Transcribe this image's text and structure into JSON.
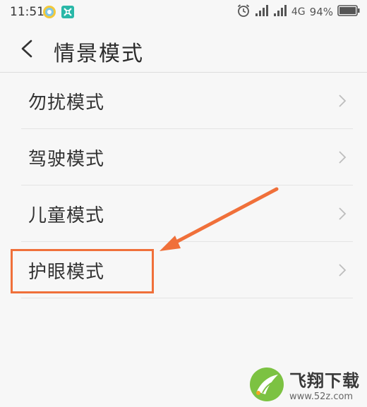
{
  "status_bar": {
    "time": "11:51",
    "network": "4G",
    "battery_percent": "94%",
    "icons": [
      "browser-icon",
      "app-icon",
      "alarm-icon",
      "signal-icon",
      "signal-icon",
      "battery-icon"
    ]
  },
  "header": {
    "back_icon": "chevron-left-icon",
    "title": "情景模式"
  },
  "list": {
    "items": [
      {
        "label": "勿扰模式"
      },
      {
        "label": "驾驶模式"
      },
      {
        "label": "儿童模式"
      },
      {
        "label": "护眼模式"
      }
    ]
  },
  "annotation": {
    "highlight_color": "#f0703a",
    "target": "护眼模式"
  },
  "watermark": {
    "title": "飞翔下载",
    "url": "www.52z.com"
  },
  "colors": {
    "background": "#f7f7f7",
    "divider": "#e4e4e4",
    "text": "#333333",
    "annotation": "#f0703a",
    "logo_green": "#7cc242"
  }
}
